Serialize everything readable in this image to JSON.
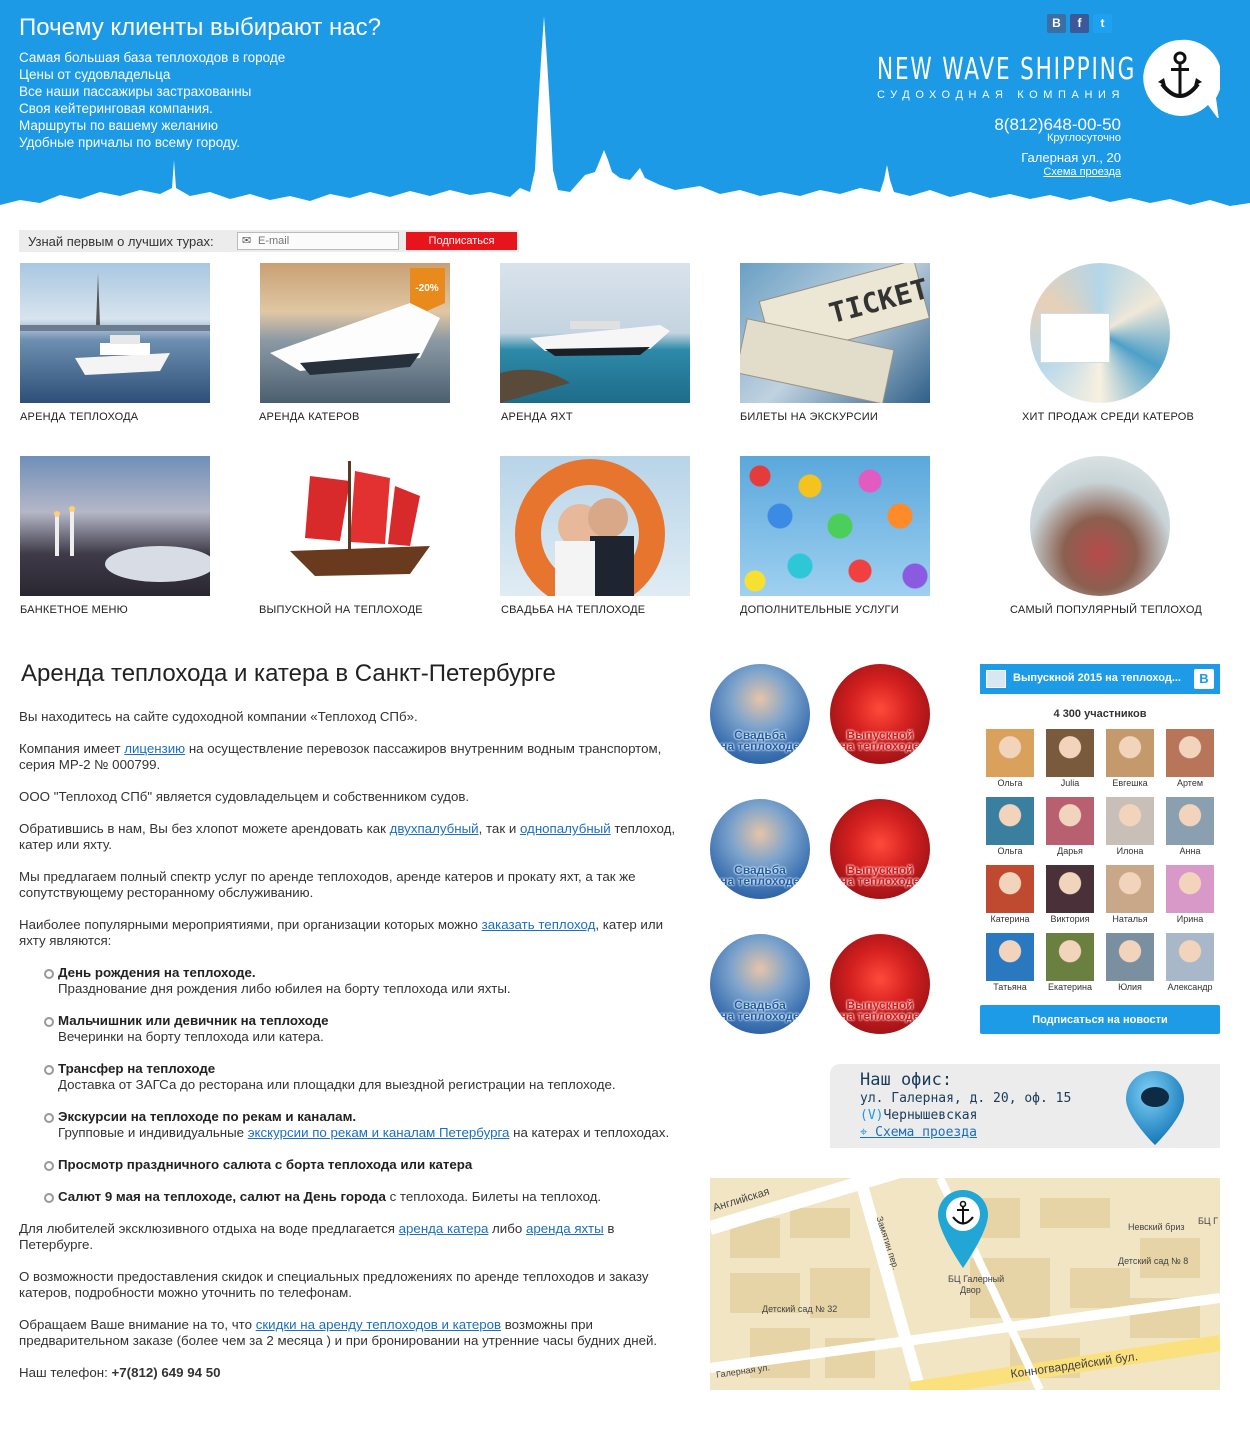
{
  "header": {
    "why_title": "Почему клиенты выбирают нас?",
    "why_items": [
      "Самая большая база теплоходов в городе",
      "Цены от судовладельца",
      "Все наши пассажиры застрахованны",
      "Своя кейтеринговая компания.",
      "Маршруты по вашему желанию",
      "Удобные причалы по всему городу."
    ],
    "social": [
      "В",
      "f",
      "t"
    ],
    "brand_name": "NEW WAVE SHIPPING",
    "brand_sub": "СУДОХОДНАЯ КОМПАНИЯ",
    "phone": "8(812)648-00-50",
    "phone_note": "Круглосуточно",
    "address": "Галерная ул., 20",
    "route_link": "Схема проезда",
    "logo_icon": "anchor-icon"
  },
  "subscribe": {
    "label": "Узнай первым о лучших турах:",
    "placeholder": "E-mail",
    "button": "Подписаться"
  },
  "tiles": [
    {
      "caption": "АРЕНДА ТЕПЛОХОДА"
    },
    {
      "caption": "АРЕНДА КАТЕРОВ",
      "badge": "-20%"
    },
    {
      "caption": "АРЕНДА ЯХТ"
    },
    {
      "caption": "БИЛЕТЫ НА ЭКСКУРСИИ",
      "ticket": "TICKET"
    },
    {
      "caption": "ХИТ ПРОДАЖ СРЕДИ КАТЕРОВ"
    },
    {
      "caption": "БАНКЕТНОЕ МЕНЮ"
    },
    {
      "caption": "ВЫПУСКНОЙ НА ТЕПЛОХОДЕ"
    },
    {
      "caption": "СВАДЬБА НА ТЕПЛОХОДЕ"
    },
    {
      "caption": "ДОПОЛНИТЕЛЬНЫЕ УСЛУГИ"
    },
    {
      "caption": "САМЫЙ ПОПУЛЯРНЫЙ ТЕПЛОХОД"
    }
  ],
  "article": {
    "title": "Аренда теплохода и катера в Санкт-Петербурге",
    "p1": "Вы находитесь на сайте судоходной компании «Теплоход СПб».",
    "p2_a": "Компания имеет ",
    "p2_link": "лицензию",
    "p2_b": " на осуществление перевозок пассажиров внутренним водным транспортом, серия МР-2 № 000799.",
    "p3": "ООО \"Теплоход СПб\" является судовладельцем и собственником судов.",
    "p4_a": "Обратившись в нам, Вы без хлопот можете арендовать как ",
    "p4_link1": "двухпалубный",
    "p4_b": ", так и ",
    "p4_link2": "однопалубный",
    "p4_c": " теплоход, катер или яхту.",
    "p5": "Мы предлагаем полный спектр услуг по аренде теплоходов, аренде катеров и прокату яхт, а так же сопутствующему ресторанному обслуживанию.",
    "p6_a": "Наиболее популярными мероприятиями, при организации которых можно ",
    "p6_link": "заказать теплоход",
    "p6_b": ", катер или яхту являются:",
    "list": [
      {
        "title": "День рождения на теплоходе.",
        "text": "Празднование дня рождения либо юбилея на борту теплохода или яхты."
      },
      {
        "title": "Мальчишник или девичник на теплоходе",
        "text": "Вечеринки на борту теплохода или катера."
      },
      {
        "title": "Трансфер на теплоходе",
        "text": "Доставка от ЗАГСа до ресторана или площадки для выездной регистрации на теплоходе."
      },
      {
        "title": "Экскурсии на теплоходе по рекам и каналам.",
        "text_a": "Групповые и индивидуальные ",
        "link": "экскурсии по рекам и каналам Петербурга",
        "text_b": " на катерах и теплоходах."
      },
      {
        "title": "Просмотр праздничного салюта с борта теплохода или катера"
      },
      {
        "title": "Салют 9 мая на теплоходе, салют на День города",
        "tail": " с теплохода. Билеты на теплоход."
      }
    ],
    "p7_a": "Для любителей эксклюзивного отдыха на воде предлагается ",
    "p7_link1": "аренда катера",
    "p7_b": " либо ",
    "p7_link2": "аренда яхты",
    "p7_c": " в Петербурге.",
    "p8": "О возможности предоставления скидок и специальных предложениях по аренде теплоходов и заказу катеров, подробности можно уточнить по телефонам.",
    "p9_a": "Обращаем Ваше внимание на то, что ",
    "p9_link": "скидки на аренду теплоходов и катеров",
    "p9_b": " возможны при предварительном заказе (более чем за 2 месяца ) и при бронировании на утренние часы будних дней.",
    "phone_label": "Наш телефон: ",
    "phone": "+7(812) 649 94 50"
  },
  "promos": {
    "wedding_1": "Свадьба",
    "wedding_2": "на теплоходе",
    "grad_1": "Выпускной",
    "grad_2": "на теплоходе"
  },
  "vk": {
    "group_title": "Выпускной 2015 на теплоход...",
    "logo": "B",
    "count": "4 300 участников",
    "members": [
      "Ольга",
      "Julia",
      "Евгешка",
      "Артем",
      "Ольга",
      "Дарья",
      "Илона",
      "Анна",
      "Катерина",
      "Виктория",
      "Наталья",
      "Ирина",
      "Татьяна",
      "Екатерина",
      "Юлия",
      "Александр"
    ],
    "member_colors": [
      "#d9a15c",
      "#7a5a3c",
      "#c49a6c",
      "#b8755a",
      "#3b7fa0",
      "#b86070",
      "#c8c0b8",
      "#8aa0b0",
      "#c04a30",
      "#4a3038",
      "#c8a888",
      "#d898c8",
      "#2a78c0",
      "#6a8040",
      "#7a90a0",
      "#a8b8c8"
    ],
    "button": "Подписаться на новости"
  },
  "office": {
    "title": "Наш офис:",
    "address": "ул. Галерная, д. 20, оф. 15",
    "metro_icon": "(V)",
    "metro": "Чернышевская",
    "route": "Схема проезда"
  },
  "map": {
    "labels": {
      "english": "Английская",
      "zamyatin": "Замятин пер.",
      "bc": "БЦ Галерный",
      "bc2": "Двор",
      "nevsky": "Невский бриз",
      "bc_short": "БЦ Г",
      "kg8": "Детский сад № 8",
      "kg32": "Детский сад № 32",
      "konn": "Конногвардейский бул.",
      "galernaya": "Галерная ул."
    }
  }
}
